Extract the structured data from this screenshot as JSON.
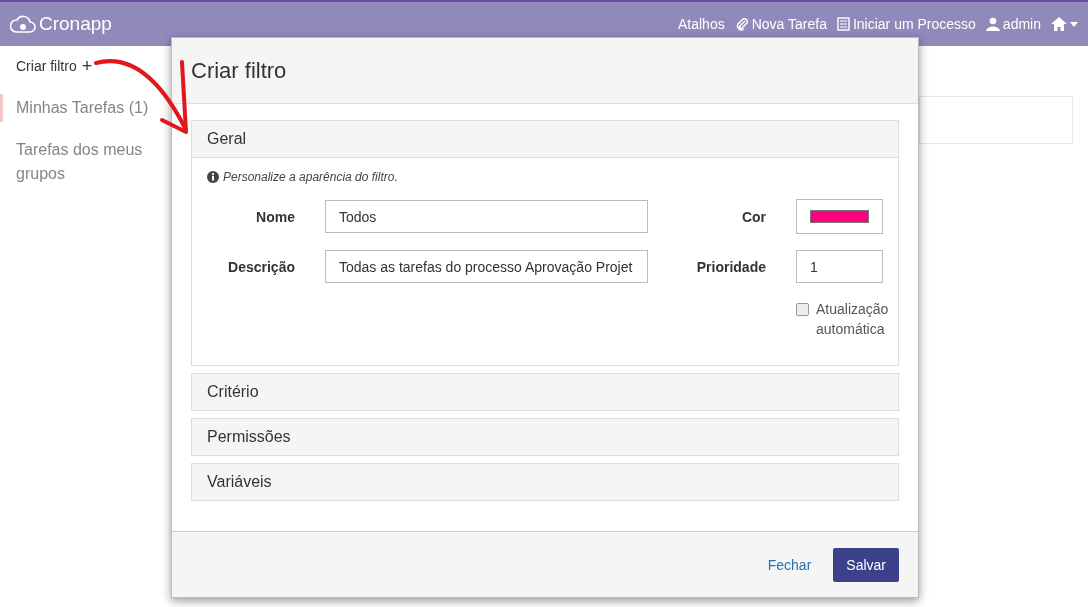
{
  "navbar": {
    "brand": "Cronapp",
    "links": [
      {
        "kind": "text",
        "label": "Atalhos"
      },
      {
        "kind": "clip",
        "label": "Nova Tarefa"
      },
      {
        "kind": "list",
        "label": "Iniciar um Processo"
      },
      {
        "kind": "user",
        "label": "admin"
      },
      {
        "kind": "home"
      }
    ]
  },
  "sidebar": {
    "create_filter": "Criar filtro",
    "create_symbol": "+",
    "items": [
      {
        "label": "Minhas Tarefas (1)",
        "selected": true
      },
      {
        "label": "Tarefas dos meus grupos",
        "selected": false
      }
    ]
  },
  "modal": {
    "title": "Criar filtro",
    "sections": [
      {
        "title": "Geral",
        "expanded": true
      },
      {
        "title": "Critério",
        "expanded": false
      },
      {
        "title": "Permissões",
        "expanded": false
      },
      {
        "title": "Variáveis",
        "expanded": false
      }
    ],
    "info": "Personalize a aparência do filtro.",
    "fields": [
      {
        "kind": "text",
        "label": "Nome",
        "value": "Todos"
      },
      {
        "kind": "color",
        "label": "Cor",
        "color": "#ff0080"
      },
      {
        "kind": "text",
        "label": "Descrição",
        "value": "Todas as tarefas do processo Aprovação Projet"
      },
      {
        "kind": "text",
        "label": "Prioridade",
        "value": "1"
      }
    ],
    "checkbox": {
      "label": "Atualização automática",
      "checked": false
    },
    "buttons": [
      {
        "kind": "link",
        "label": "Fechar"
      },
      {
        "kind": "primary",
        "label": "Salvar"
      }
    ]
  }
}
